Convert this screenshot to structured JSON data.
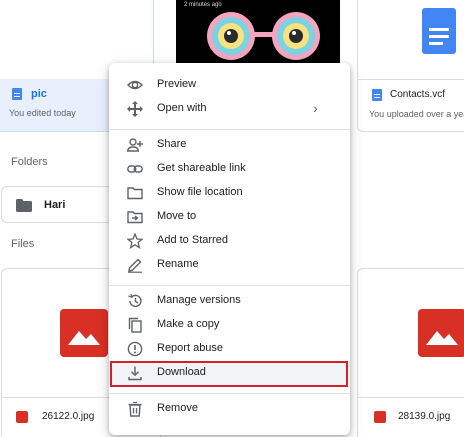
{
  "top_files": [
    {
      "name": "pic",
      "subtitle": "You edited today"
    },
    {
      "name": "",
      "subtitle": "",
      "overlay_text": "2 minutes ago"
    },
    {
      "name": "Contacts.vcf",
      "subtitle": "You uploaded over a year"
    }
  ],
  "sections": {
    "folders_label": "Folders",
    "files_label": "Files"
  },
  "folders": [
    {
      "name": "Hari"
    }
  ],
  "bottom_files": [
    {
      "name": "26122.0.jpg"
    },
    {
      "name": "28139.0.jpg"
    }
  ],
  "context_menu": {
    "items": [
      {
        "label": "Preview",
        "icon": "eye-icon"
      },
      {
        "label": "Open with",
        "icon": "move-arrows-icon",
        "submenu_indicator": "›"
      },
      {
        "label": "Share",
        "icon": "person-add-icon"
      },
      {
        "label": "Get shareable link",
        "icon": "link-icon"
      },
      {
        "label": "Show file location",
        "icon": "folder-outline-icon"
      },
      {
        "label": "Move to",
        "icon": "move-to-folder-icon"
      },
      {
        "label": "Add to Starred",
        "icon": "star-outline-icon"
      },
      {
        "label": "Rename",
        "icon": "pencil-icon"
      },
      {
        "label": "Manage versions",
        "icon": "history-icon"
      },
      {
        "label": "Make a copy",
        "icon": "copy-icon"
      },
      {
        "label": "Report abuse",
        "icon": "alert-circle-icon"
      },
      {
        "label": "Download",
        "icon": "download-icon",
        "highlighted": true
      },
      {
        "label": "Remove",
        "icon": "trash-icon"
      }
    ]
  },
  "colors": {
    "doc_blue": "#4285f4",
    "image_red": "#d93025",
    "highlight_border": "#d3212a",
    "selected_card_bg": "#e8f0fe"
  }
}
